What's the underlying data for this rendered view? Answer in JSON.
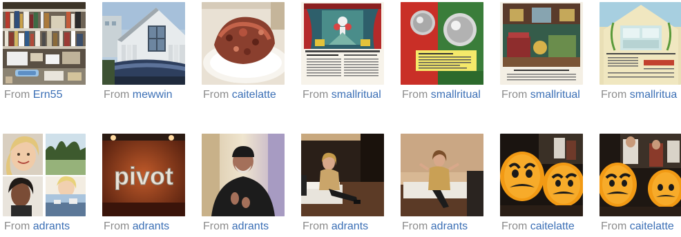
{
  "gallery": {
    "rows": [
      {
        "items": [
          {
            "prefix": "From",
            "user": "Ern55",
            "thumb_icon": "bookshelf-photo-icon"
          },
          {
            "prefix": "From",
            "user": "mewwin",
            "thumb_icon": "house-photo-icon"
          },
          {
            "prefix": "From",
            "user": "caitelatte",
            "thumb_icon": "cake-photo-icon"
          },
          {
            "prefix": "From",
            "user": "smallritual",
            "thumb_icon": "vintage-ad-stage-icon"
          },
          {
            "prefix": "From",
            "user": "smallritual",
            "thumb_icon": "vintage-ad-knobs-icon"
          },
          {
            "prefix": "From",
            "user": "smallritual",
            "thumb_icon": "vintage-ad-room-icon"
          },
          {
            "prefix": "From",
            "user": "smallritua",
            "thumb_icon": "vintage-ad-stove-icon"
          }
        ]
      },
      {
        "items": [
          {
            "prefix": "From",
            "user": "adrants",
            "thumb_icon": "portrait-collage-icon"
          },
          {
            "prefix": "From",
            "user": "adrants",
            "thumb_icon": "pivot-sign-photo-icon"
          },
          {
            "prefix": "From",
            "user": "adrants",
            "thumb_icon": "speaker-photo-icon"
          },
          {
            "prefix": "From",
            "user": "adrants",
            "thumb_icon": "panel-photo-icon"
          },
          {
            "prefix": "From",
            "user": "adrants",
            "thumb_icon": "panel-photo-2-icon"
          },
          {
            "prefix": "From",
            "user": "caitelatte",
            "thumb_icon": "pumpkin-faces-photo-icon"
          },
          {
            "prefix": "From",
            "user": "caitelatte",
            "thumb_icon": "pumpkin-faces-photo-2-icon"
          }
        ]
      }
    ],
    "thumb_text": {
      "pivot_sign": "pivot"
    }
  }
}
